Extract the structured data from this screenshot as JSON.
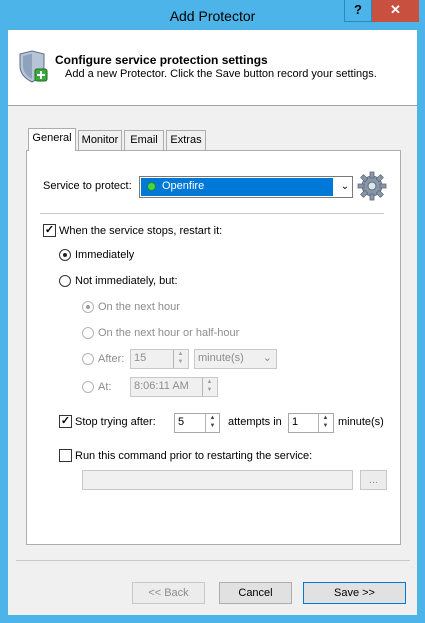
{
  "window": {
    "title": "Add Protector",
    "help_label": "?",
    "close_label": "✕"
  },
  "banner": {
    "title": "Configure service protection settings",
    "subtitle": "Add a new Protector. Click the Save button record your settings.",
    "icon": "shield-plus-icon"
  },
  "tabs": [
    {
      "label": "General",
      "active": true
    },
    {
      "label": "Monitor",
      "active": false
    },
    {
      "label": "Email",
      "active": false
    },
    {
      "label": "Extras",
      "active": false
    }
  ],
  "general": {
    "service_label": "Service to protect:",
    "service_value": "Openfire",
    "restart_label": "When the service stops, restart it:",
    "restart_checked": true,
    "immediately_label": "Immediately",
    "not_immediately_label": "Not immediately, but:",
    "next_hour_label": "On the next hour",
    "next_half_hour_label": "On the next hour or half-hour",
    "after_label": "After:",
    "after_value": "15",
    "after_unit": "minute(s)",
    "at_label": "At:",
    "at_value": "8:06:11 AM",
    "stop_trying_label": "Stop trying after:",
    "stop_trying_checked": true,
    "attempts_value": "5",
    "attempts_in_label": "attempts in",
    "minutes_value": "1",
    "minutes_label": "minute(s)",
    "run_command_label": "Run this command prior to restarting the service:",
    "run_command_checked": false,
    "command_value": "",
    "browse_label": "..."
  },
  "buttons": {
    "back": "<< Back",
    "cancel": "Cancel",
    "save": "Save >>"
  },
  "colors": {
    "titlebar": "#4cb4e8",
    "close": "#c7503f",
    "selection": "#0078d7"
  }
}
